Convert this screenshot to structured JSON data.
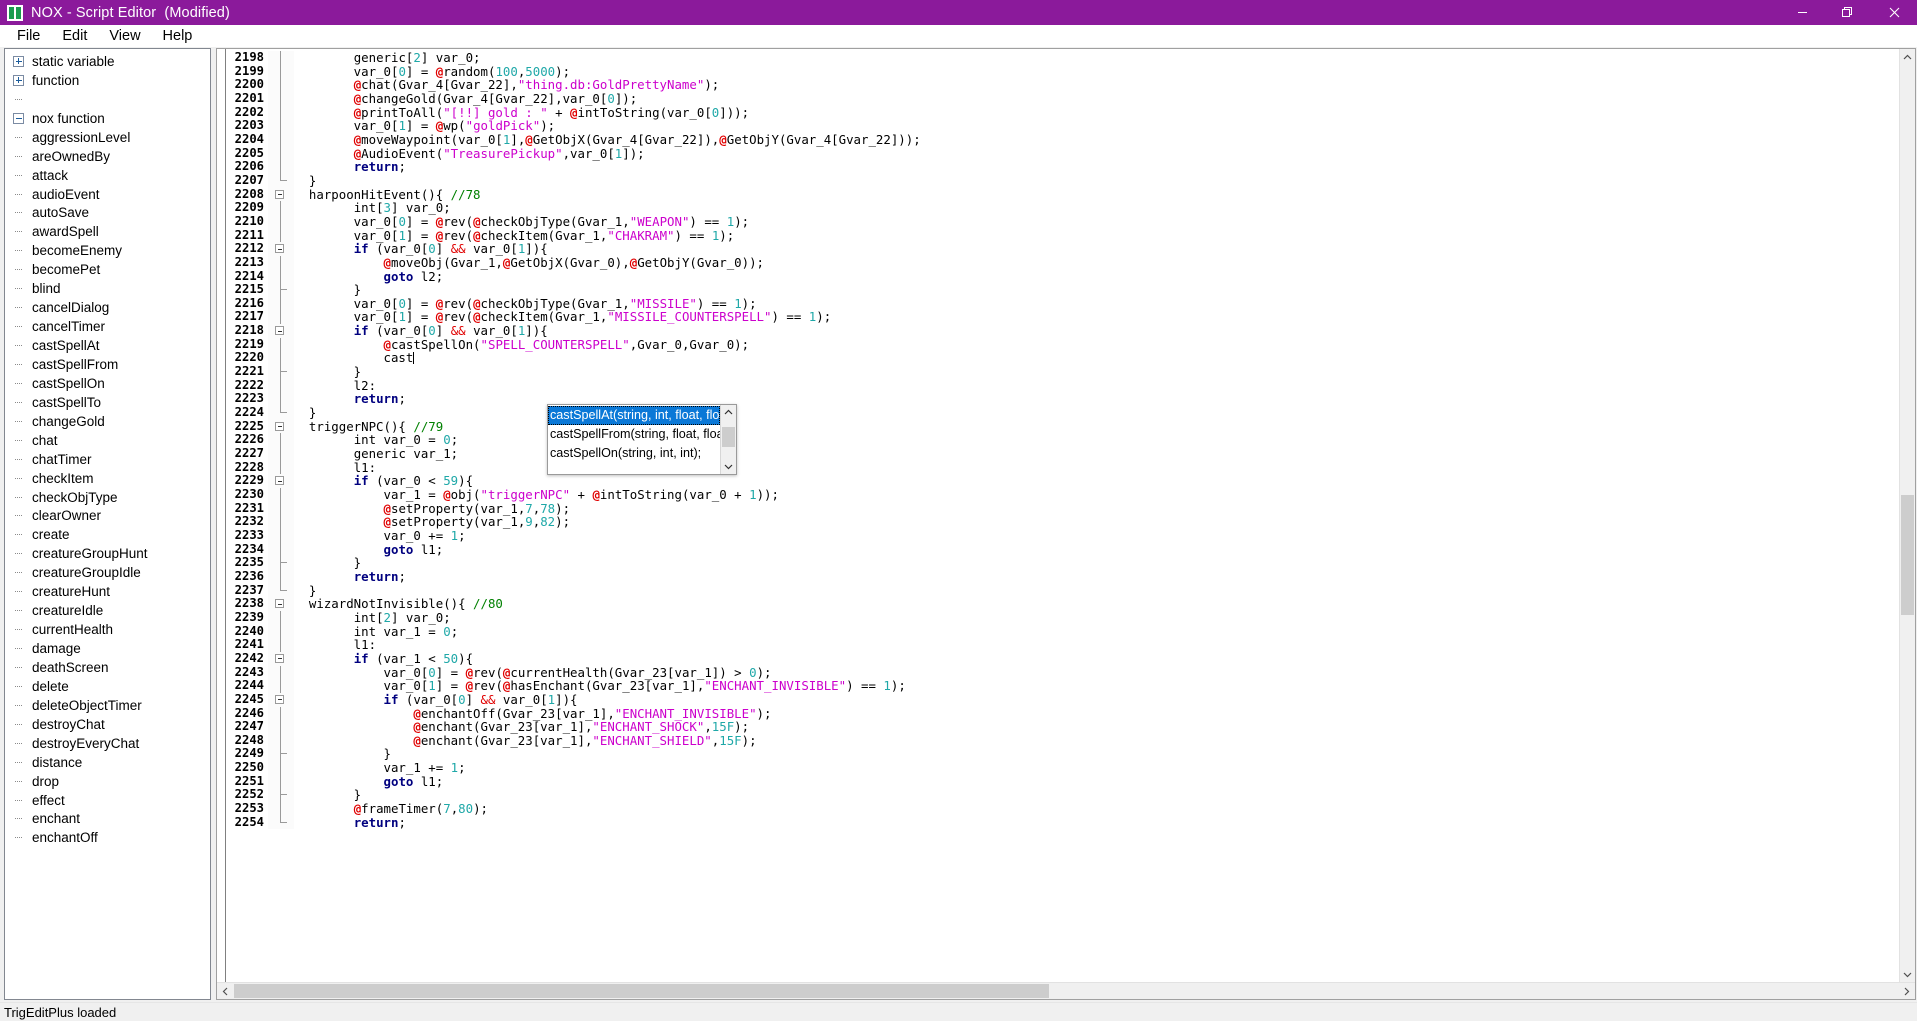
{
  "window": {
    "title": "NOX - Script Editor  (Modified)",
    "icon": "app-icon",
    "controls": {
      "minimize": "minimize-icon",
      "maximize": "restore-icon",
      "close": "close-icon"
    },
    "titlebar_color": "#8B1A9B"
  },
  "menubar": {
    "items": [
      {
        "label": "File"
      },
      {
        "label": "Edit"
      },
      {
        "label": "View"
      },
      {
        "label": "Help"
      }
    ]
  },
  "sidebar": {
    "nodes": [
      {
        "label": "static variable",
        "type": "root",
        "state": "collapsed"
      },
      {
        "label": "function",
        "type": "root",
        "state": "collapsed"
      },
      {
        "label": "",
        "type": "spacer",
        "state": "none"
      },
      {
        "label": "nox function",
        "type": "root",
        "state": "expanded"
      },
      {
        "label": "aggressionLevel",
        "type": "child"
      },
      {
        "label": "areOwnedBy",
        "type": "child"
      },
      {
        "label": "attack",
        "type": "child"
      },
      {
        "label": "audioEvent",
        "type": "child"
      },
      {
        "label": "autoSave",
        "type": "child"
      },
      {
        "label": "awardSpell",
        "type": "child"
      },
      {
        "label": "becomeEnemy",
        "type": "child"
      },
      {
        "label": "becomePet",
        "type": "child"
      },
      {
        "label": "blind",
        "type": "child"
      },
      {
        "label": "cancelDialog",
        "type": "child"
      },
      {
        "label": "cancelTimer",
        "type": "child"
      },
      {
        "label": "castSpellAt",
        "type": "child"
      },
      {
        "label": "castSpellFrom",
        "type": "child"
      },
      {
        "label": "castSpellOn",
        "type": "child"
      },
      {
        "label": "castSpellTo",
        "type": "child"
      },
      {
        "label": "changeGold",
        "type": "child"
      },
      {
        "label": "chat",
        "type": "child"
      },
      {
        "label": "chatTimer",
        "type": "child"
      },
      {
        "label": "checkItem",
        "type": "child"
      },
      {
        "label": "checkObjType",
        "type": "child"
      },
      {
        "label": "clearOwner",
        "type": "child"
      },
      {
        "label": "create",
        "type": "child"
      },
      {
        "label": "creatureGroupHunt",
        "type": "child"
      },
      {
        "label": "creatureGroupIdle",
        "type": "child"
      },
      {
        "label": "creatureHunt",
        "type": "child"
      },
      {
        "label": "creatureIdle",
        "type": "child"
      },
      {
        "label": "currentHealth",
        "type": "child"
      },
      {
        "label": "damage",
        "type": "child"
      },
      {
        "label": "deathScreen",
        "type": "child"
      },
      {
        "label": "delete",
        "type": "child"
      },
      {
        "label": "deleteObjectTimer",
        "type": "child"
      },
      {
        "label": "destroyChat",
        "type": "child"
      },
      {
        "label": "destroyEveryChat",
        "type": "child"
      },
      {
        "label": "distance",
        "type": "child"
      },
      {
        "label": "drop",
        "type": "child"
      },
      {
        "label": "effect",
        "type": "child"
      },
      {
        "label": "enchant",
        "type": "child"
      },
      {
        "label": "enchantOff",
        "type": "child"
      }
    ]
  },
  "editor": {
    "first_line_number": 2198,
    "lines": [
      {
        "n": 2198,
        "fold": "bar",
        "html": "        <span class='ty'>generic</span>[<span class='num'>2</span>] var_0;"
      },
      {
        "n": 2199,
        "fold": "bar",
        "html": "        var_0[<span class='num'>0</span>] = <span class='at'>@</span>random(<span class='num'>100</span>,<span class='num'>5000</span>);"
      },
      {
        "n": 2200,
        "fold": "bar",
        "html": "        <span class='at'>@</span>chat(Gvar_4[Gvar_22],<span class='str'>\"thing.db:GoldPrettyName\"</span>);"
      },
      {
        "n": 2201,
        "fold": "bar",
        "html": "        <span class='at'>@</span>changeGold(Gvar_4[Gvar_22],var_0[<span class='num'>0</span>]);"
      },
      {
        "n": 2202,
        "fold": "bar",
        "html": "        <span class='at'>@</span>printToAll(<span class='str'>\"[!!] gold : \"</span> + <span class='at'>@</span>intToString(var_0[<span class='num'>0</span>]));"
      },
      {
        "n": 2203,
        "fold": "bar",
        "html": "        var_0[<span class='num'>1</span>] = <span class='at'>@</span>wp(<span class='str'>\"goldPick\"</span>);"
      },
      {
        "n": 2204,
        "fold": "bar",
        "html": "        <span class='at'>@</span>moveWaypoint(var_0[<span class='num'>1</span>],<span class='at'>@</span>GetObjX(Gvar_4[Gvar_22]),<span class='at'>@</span>GetObjY(Gvar_4[Gvar_22]));"
      },
      {
        "n": 2205,
        "fold": "bar",
        "html": "        <span class='at'>@</span>AudioEvent(<span class='str'>\"TreasurePickup\"</span>,var_0[<span class='num'>1</span>]);"
      },
      {
        "n": 2206,
        "fold": "bar",
        "html": "        <span class='k'>return</span>;"
      },
      {
        "n": 2207,
        "fold": "end",
        "html": "  }"
      },
      {
        "n": 2208,
        "fold": "box",
        "html": "  harpoonHitEvent(){ <span class='cm'>//78</span>"
      },
      {
        "n": 2209,
        "fold": "bar",
        "html": "        <span class='ty'>int</span>[<span class='num'>3</span>] var_0;"
      },
      {
        "n": 2210,
        "fold": "bar",
        "html": "        var_0[<span class='num'>0</span>] = <span class='at'>@</span>rev(<span class='at'>@</span>checkObjType(Gvar_1,<span class='str'>\"WEAPON\"</span>) == <span class='num'>1</span>);"
      },
      {
        "n": 2211,
        "fold": "bar",
        "html": "        var_0[<span class='num'>1</span>] = <span class='at'>@</span>rev(<span class='at'>@</span>checkItem(Gvar_1,<span class='str'>\"CHAKRAM\"</span>) == <span class='num'>1</span>);"
      },
      {
        "n": 2212,
        "fold": "box",
        "html": "        <span class='k'>if</span> (var_0[<span class='num'>0</span>] <span class='op'>&&</span> var_0[<span class='num'>1</span>]){"
      },
      {
        "n": 2213,
        "fold": "bar",
        "html": "            <span class='at'>@</span>moveObj(Gvar_1,<span class='at'>@</span>GetObjX(Gvar_0),<span class='at'>@</span>GetObjY(Gvar_0));"
      },
      {
        "n": 2214,
        "fold": "bar",
        "html": "            <span class='k'>goto</span> l2;"
      },
      {
        "n": 2215,
        "fold": "tick",
        "html": "        }"
      },
      {
        "n": 2216,
        "fold": "bar",
        "html": "        var_0[<span class='num'>0</span>] = <span class='at'>@</span>rev(<span class='at'>@</span>checkObjType(Gvar_1,<span class='str'>\"MISSILE\"</span>) == <span class='num'>1</span>);"
      },
      {
        "n": 2217,
        "fold": "bar",
        "html": "        var_0[<span class='num'>1</span>] = <span class='at'>@</span>rev(<span class='at'>@</span>checkItem(Gvar_1,<span class='str'>\"MISSILE_COUNTERSPELL\"</span>) == <span class='num'>1</span>);"
      },
      {
        "n": 2218,
        "fold": "box",
        "html": "        <span class='k'>if</span> (var_0[<span class='num'>0</span>] <span class='op'>&&</span> var_0[<span class='num'>1</span>]){"
      },
      {
        "n": 2219,
        "fold": "bar",
        "html": "            <span class='at'>@</span>castSpellOn(<span class='str'>\"SPELL_COUNTERSPELL\"</span>,Gvar_0,Gvar_0);"
      },
      {
        "n": 2220,
        "fold": "bar",
        "html": "            cast<span class='caret'></span>"
      },
      {
        "n": 2221,
        "fold": "tick",
        "html": "        }"
      },
      {
        "n": 2222,
        "fold": "bar",
        "html": "        l2:"
      },
      {
        "n": 2223,
        "fold": "bar",
        "html": "        <span class='k'>return</span>;"
      },
      {
        "n": 2224,
        "fold": "end",
        "html": "  }"
      },
      {
        "n": 2225,
        "fold": "box",
        "html": "  triggerNPC(){ <span class='cm'>//79</span>"
      },
      {
        "n": 2226,
        "fold": "bar",
        "html": "        <span class='ty'>int</span> var_0 = <span class='num'>0</span>;"
      },
      {
        "n": 2227,
        "fold": "bar",
        "html": "        <span class='ty'>generic</span> var_1;"
      },
      {
        "n": 2228,
        "fold": "bar",
        "html": "        l1:"
      },
      {
        "n": 2229,
        "fold": "box",
        "html": "        <span class='k'>if</span> (var_0 &lt; <span class='num'>59</span>){"
      },
      {
        "n": 2230,
        "fold": "bar",
        "html": "            var_1 = <span class='at'>@</span>obj(<span class='str'>\"triggerNPC\"</span> + <span class='at'>@</span>intToString(var_0 + <span class='num'>1</span>));"
      },
      {
        "n": 2231,
        "fold": "bar",
        "html": "            <span class='at'>@</span>setProperty(var_1,<span class='num'>7</span>,<span class='num'>78</span>);"
      },
      {
        "n": 2232,
        "fold": "bar",
        "html": "            <span class='at'>@</span>setProperty(var_1,<span class='num'>9</span>,<span class='num'>82</span>);"
      },
      {
        "n": 2233,
        "fold": "bar",
        "html": "            var_0 += <span class='num'>1</span>;"
      },
      {
        "n": 2234,
        "fold": "bar",
        "html": "            <span class='k'>goto</span> l1;"
      },
      {
        "n": 2235,
        "fold": "tick",
        "html": "        }"
      },
      {
        "n": 2236,
        "fold": "bar",
        "html": "        <span class='k'>return</span>;"
      },
      {
        "n": 2237,
        "fold": "end",
        "html": "  }"
      },
      {
        "n": 2238,
        "fold": "box",
        "html": "  wizardNotInvisible(){ <span class='cm'>//80</span>"
      },
      {
        "n": 2239,
        "fold": "bar",
        "html": "        <span class='ty'>int</span>[<span class='num'>2</span>] var_0;"
      },
      {
        "n": 2240,
        "fold": "bar",
        "html": "        <span class='ty'>int</span> var_1 = <span class='num'>0</span>;"
      },
      {
        "n": 2241,
        "fold": "bar",
        "html": "        l1:"
      },
      {
        "n": 2242,
        "fold": "box",
        "html": "        <span class='k'>if</span> (var_1 &lt; <span class='num'>50</span>){"
      },
      {
        "n": 2243,
        "fold": "bar",
        "html": "            var_0[<span class='num'>0</span>] = <span class='at'>@</span>rev(<span class='at'>@</span>currentHealth(Gvar_23[var_1]) &gt; <span class='num'>0</span>);"
      },
      {
        "n": 2244,
        "fold": "bar",
        "html": "            var_0[<span class='num'>1</span>] = <span class='at'>@</span>rev(<span class='at'>@</span>hasEnchant(Gvar_23[var_1],<span class='str'>\"ENCHANT_INVISIBLE\"</span>) == <span class='num'>1</span>);"
      },
      {
        "n": 2245,
        "fold": "box",
        "html": "            <span class='k'>if</span> (var_0[<span class='num'>0</span>] <span class='op'>&&</span> var_0[<span class='num'>1</span>]){"
      },
      {
        "n": 2246,
        "fold": "bar",
        "html": "                <span class='at'>@</span>enchantOff(Gvar_23[var_1],<span class='str'>\"ENCHANT_INVISIBLE\"</span>);"
      },
      {
        "n": 2247,
        "fold": "bar",
        "html": "                <span class='at'>@</span>enchant(Gvar_23[var_1],<span class='str'>\"ENCHANT_SHOCK\"</span>,<span class='num'>15F</span>);"
      },
      {
        "n": 2248,
        "fold": "bar",
        "html": "                <span class='at'>@</span>enchant(Gvar_23[var_1],<span class='str'>\"ENCHANT_SHIELD\"</span>,<span class='num'>15F</span>);"
      },
      {
        "n": 2249,
        "fold": "tick",
        "html": "            }"
      },
      {
        "n": 2250,
        "fold": "bar",
        "html": "            var_1 += <span class='num'>1</span>;"
      },
      {
        "n": 2251,
        "fold": "bar",
        "html": "            <span class='k'>goto</span> l1;"
      },
      {
        "n": 2252,
        "fold": "tick",
        "html": "        }"
      },
      {
        "n": 2253,
        "fold": "bar",
        "html": "        <span class='at'>@</span>frameTimer(<span class='num'>7</span>,<span class='num'>80</span>);"
      },
      {
        "n": 2254,
        "fold": "end2",
        "html": "        <span class='k'>return</span>;"
      }
    ]
  },
  "autocomplete": {
    "items": [
      {
        "label": "castSpellAt(string, int, float, float);",
        "selected": true
      },
      {
        "label": "castSpellFrom(string, float, float, floa",
        "selected": false
      },
      {
        "label": "castSpellOn(string, int, int);",
        "selected": false
      }
    ],
    "scroll_up": "chevron-up-icon",
    "scroll_down": "chevron-down-icon"
  },
  "scrollbars": {
    "vertical_up": "chevron-up-icon",
    "vertical_down": "chevron-down-icon",
    "horizontal_left": "chevron-left-icon",
    "horizontal_right": "chevron-right-icon"
  },
  "statusbar": {
    "message": "TrigEditPlus loaded"
  }
}
